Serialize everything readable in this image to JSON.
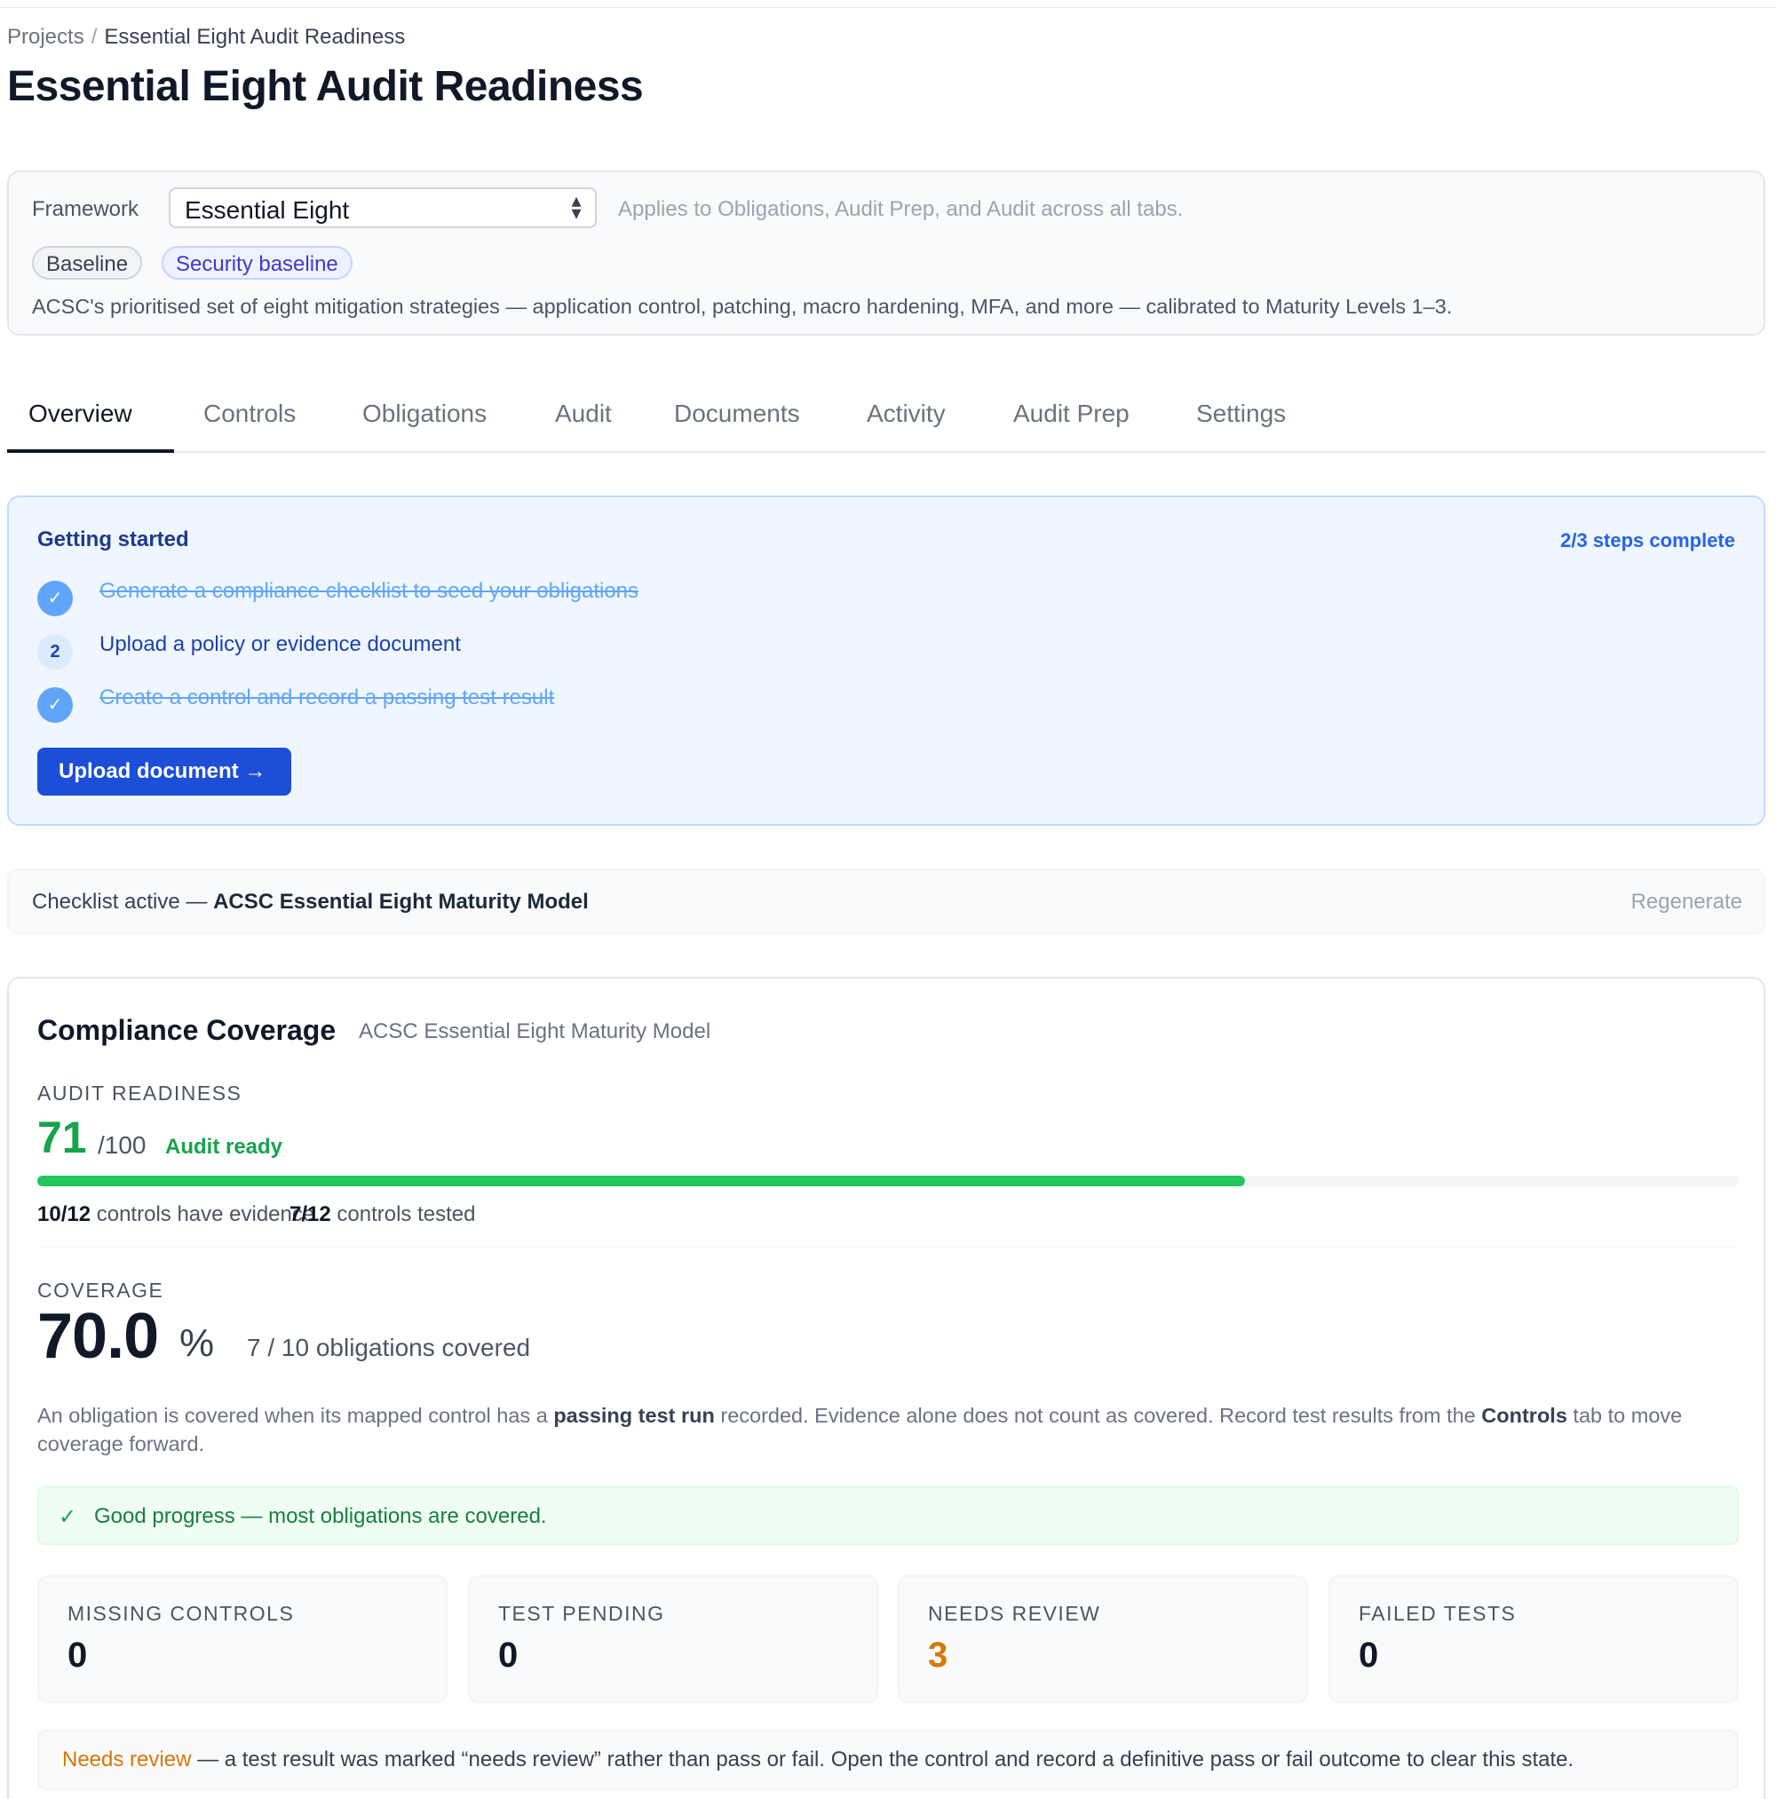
{
  "breadcrumb": {
    "root": "Projects",
    "separator": "/",
    "current": "Essential Eight Audit Readiness"
  },
  "page": {
    "title": "Essential Eight Audit Readiness"
  },
  "framework": {
    "label": "Framework",
    "selected": "Essential Eight",
    "help": "Applies to Obligations, Audit Prep, and Audit across all tabs.",
    "tags": [
      "Baseline",
      "Security baseline"
    ],
    "description": "ACSC's prioritised set of eight mitigation strategies — application control, patching, macro hardening, MFA, and more — calibrated to Maturity Levels 1–3."
  },
  "tabs": [
    "Overview",
    "Controls",
    "Obligations",
    "Audit",
    "Documents",
    "Activity",
    "Audit Prep",
    "Settings"
  ],
  "active_tab": "Overview",
  "getting_started": {
    "title": "Getting started",
    "progress": "2/3 steps complete",
    "steps": [
      {
        "marker": "✓",
        "label": "Generate a compliance checklist to seed your obligations",
        "done": true
      },
      {
        "marker": "2",
        "label": "Upload a policy or evidence document",
        "done": false
      },
      {
        "marker": "✓",
        "label": "Create a control and record a passing test result",
        "done": true
      }
    ],
    "button": "Upload document →"
  },
  "checklist": {
    "prefix": "Checklist active — ",
    "name": "ACSC Essential Eight Maturity Model",
    "action": "Regenerate"
  },
  "coverage": {
    "title": "Compliance Coverage",
    "subtitle": "ACSC Essential Eight Maturity Model",
    "readiness_label": "AUDIT READINESS",
    "readiness_score": "71",
    "readiness_max": "/100",
    "readiness_status": "Audit ready",
    "readiness_fraction": 0.71,
    "evidence_count": "10/12",
    "evidence_text": "controls have evidence",
    "tested_count": "7/12",
    "tested_text": "controls tested",
    "coverage_label": "COVERAGE",
    "coverage_value": "70.0",
    "coverage_unit": "%",
    "coverage_detail": "7 / 10 obligations covered",
    "note": {
      "p1": "An obligation is covered when its mapped control has a ",
      "b1": "passing test run",
      "p2": " recorded. Evidence alone does not count as covered. Record test results from the ",
      "b2": "Controls",
      "p3": " tab to move coverage forward."
    },
    "banner_icon": "check-icon",
    "banner": "Good progress — most obligations are covered.",
    "metrics": [
      {
        "label": "MISSING CONTROLS",
        "value": "0"
      },
      {
        "label": "TEST PENDING",
        "value": "0"
      },
      {
        "label": "NEEDS REVIEW",
        "value": "3"
      },
      {
        "label": "FAILED TESTS",
        "value": "0"
      }
    ],
    "needs_review_note": {
      "highlight": "Needs review",
      "text": " — a test result was marked “needs review” rather than pass or fail. Open the control and record a definitive pass or fail outcome to clear this state."
    }
  },
  "colors": {
    "accent": "#1d4ed8",
    "success": "#16a34a",
    "warning": "#d97706"
  }
}
